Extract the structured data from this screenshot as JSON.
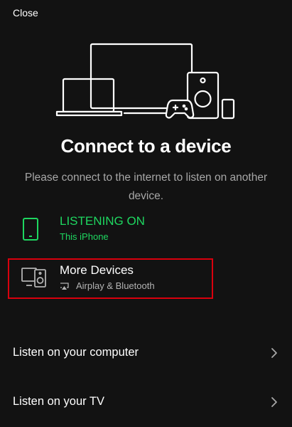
{
  "header": {
    "close_label": "Close"
  },
  "hero": {
    "title": "Connect to a device",
    "subtitle": "Please connect to the internet to listen on another device."
  },
  "current_device": {
    "status_label": "LISTENING ON",
    "device_name": "This iPhone",
    "icon": "phone-icon"
  },
  "more_devices": {
    "title": "More Devices",
    "subtitle": "Airplay & Bluetooth",
    "icon": "speaker-desktop-icon",
    "sub_icon": "airplay-icon"
  },
  "options": [
    {
      "label": "Listen on your computer",
      "icon": "chevron-right-icon"
    },
    {
      "label": "Listen on your TV",
      "icon": "chevron-right-icon"
    }
  ],
  "colors": {
    "background": "#121212",
    "accent_green": "#1ed760",
    "muted_text": "#a7a7a7",
    "highlight_red": "#d9000d"
  }
}
